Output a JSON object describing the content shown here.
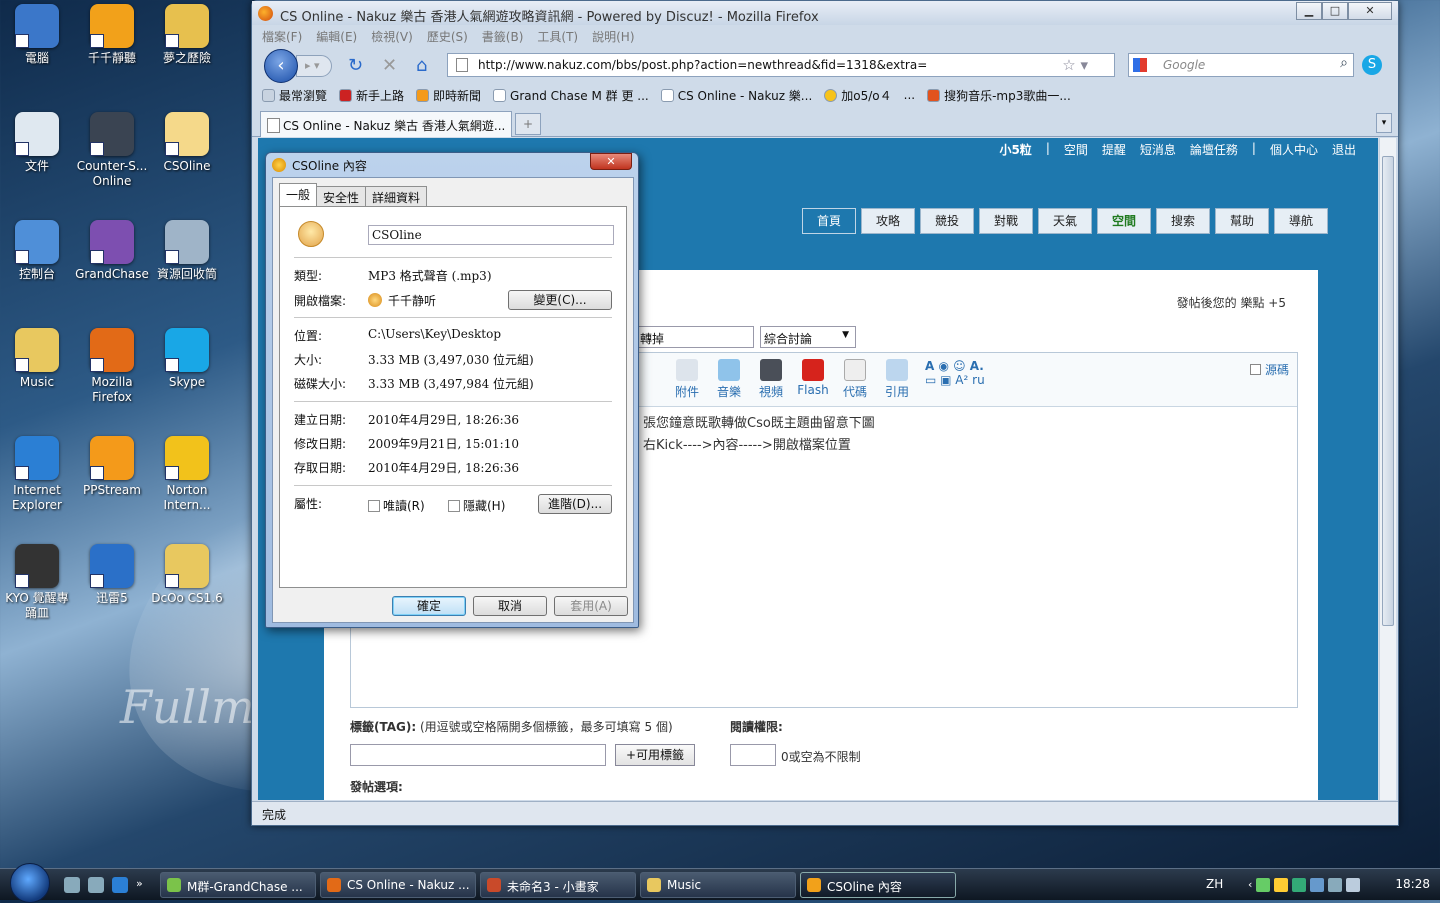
{
  "desktop": {
    "icons": [
      {
        "label": "電腦",
        "color": "#3b77c9"
      },
      {
        "label": "千千靜聽",
        "color": "#f2a11a"
      },
      {
        "label": "夢之歷險",
        "color": "#e7c04e"
      },
      {
        "label": "文件",
        "color": "#dfe8f0"
      },
      {
        "label": "Counter-S... Online",
        "color": "#3a4452"
      },
      {
        "label": "CSOline",
        "color": "#f5d98a"
      },
      {
        "label": "控制台",
        "color": "#4f8fd8"
      },
      {
        "label": "GrandChase",
        "color": "#7d4fb0"
      },
      {
        "label": "資源回收筒",
        "color": "#9fb4c8"
      },
      {
        "label": "Music",
        "color": "#e8c85f"
      },
      {
        "label": "Mozilla Firefox",
        "color": "#e26a17"
      },
      {
        "label": "Skype",
        "color": "#19a7e6"
      },
      {
        "label": "Internet Explorer",
        "color": "#2b7fd4"
      },
      {
        "label": "PPStream",
        "color": "#f49a1a"
      },
      {
        "label": "Norton Intern...",
        "color": "#f2c21b"
      },
      {
        "label": "KYO 覺醒專 踊皿",
        "color": "#333"
      },
      {
        "label": "迅雷5",
        "color": "#2b70c8"
      },
      {
        "label": "DcOo CS1.6",
        "color": "#e8c85f"
      }
    ],
    "wallpaper_text": "Fullmetal"
  },
  "firefox": {
    "title": "CS Online - Nakuz 樂古 香港人氣網遊攻略資訊網 - Powered by Discuz! - Mozilla Firefox",
    "menu": [
      "檔案(F)",
      "編輯(E)",
      "檢視(V)",
      "歷史(S)",
      "書籤(B)",
      "工具(T)",
      "說明(H)"
    ],
    "url": "http://www.nakuz.com/bbs/post.php?action=newthread&fid=1318&extra=",
    "search_placeholder": "Google",
    "bookmarks": [
      "最常瀏覽",
      "新手上路",
      "即時新聞",
      "Grand Chase M 群 更 ...",
      "CS Online - Nakuz 樂...",
      "加o5/o４",
      "...",
      "搜狗音乐-mp3歌曲一..."
    ],
    "tab_title": "CS Online - Nakuz 樂古 香港人氣網遊...",
    "newtab": "+",
    "status": "完成"
  },
  "site": {
    "user": "小5粒",
    "toplinks": [
      "空間",
      "提醒",
      "短消息",
      "論壇任務",
      "個人中心",
      "退出"
    ],
    "nav": [
      "首頁",
      "攻略",
      "競投",
      "對戰",
      "天氣",
      "空間",
      "搜索",
      "幫助",
      "導航"
    ],
    "credits": "發帖後您的 樂點 +5",
    "subject": "轉掉",
    "category": "綜合討論",
    "toolbar": [
      "附件",
      "音樂",
      "視頻",
      "Flash",
      "代碼",
      "引用"
    ],
    "source_label": "源碼",
    "editor_lines": [
      "張您鐘意既歌轉做Cso既主題曲留意下圖",
      "右Kick---->內容----->開啟檔案位置"
    ],
    "tag_label": "標籤(TAG):",
    "tag_hint": "(用逗號或空格隔開多個標籤，最多可填寫 5 個)",
    "tag_button": "+可用標籤",
    "read_label": "閱讀權限:",
    "read_hint": "0或空為不限制",
    "post_options": "發帖選項:"
  },
  "dialog": {
    "title": "CSOline 內容",
    "tabs": [
      "一般",
      "安全性",
      "詳細資料"
    ],
    "filename": "CSOline",
    "type_label": "類型:",
    "type_value": "MP3 格式聲音 (.mp3)",
    "open_label": "開啟檔案:",
    "open_value": "千千静听",
    "change_button": "變更(C)...",
    "loc_label": "位置:",
    "loc_value": "C:\\Users\\Key\\Desktop",
    "size_label": "大小:",
    "size_value": "3.33 MB (3,497,030 位元組)",
    "disk_label": "磁碟大小:",
    "disk_value": "3.33 MB (3,497,984 位元組)",
    "created_label": "建立日期:",
    "created_value": "2010年4月29日, 18:26:36",
    "modified_label": "修改日期:",
    "modified_value": "2009年9月21日, 15:01:10",
    "accessed_label": "存取日期:",
    "accessed_value": "2010年4月29日, 18:26:36",
    "attr_label": "屬性:",
    "readonly": "唯讀(R)",
    "hidden": "隱藏(H)",
    "advanced": "進階(D)...",
    "ok": "確定",
    "cancel": "取消",
    "apply": "套用(A)"
  },
  "taskbar": {
    "tasks": [
      {
        "label": "M群-GrandChase ...",
        "color": "#7bc34a"
      },
      {
        "label": "CS Online - Nakuz ...",
        "color": "#e26a17"
      },
      {
        "label": "未命名3 - 小畫家",
        "color": "#c94a2a"
      },
      {
        "label": "Music",
        "color": "#e8c85f"
      },
      {
        "label": "CSOline 內容",
        "color": "#f2a11a"
      }
    ],
    "lang": "ZH",
    "clock": "18:28"
  }
}
